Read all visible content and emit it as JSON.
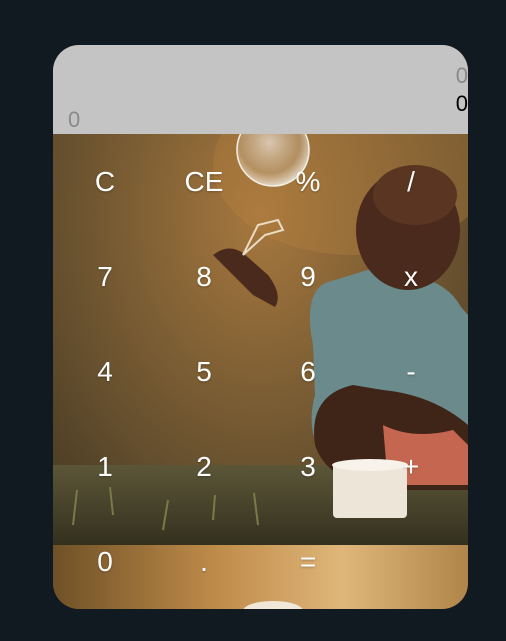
{
  "display": {
    "left_value": "0",
    "right_value_top": "0",
    "right_value_bottom": "0"
  },
  "keys": {
    "row1": [
      "C",
      "CE",
      "%",
      "/"
    ],
    "row2": [
      "7",
      "8",
      "9",
      "x"
    ],
    "row3": [
      "4",
      "5",
      "6",
      "-"
    ],
    "row4": [
      "1",
      "2",
      "3",
      "+"
    ],
    "row5": [
      "0",
      ".",
      "="
    ]
  },
  "colors": {
    "page_background": "#111921",
    "display_background": "#c4c4c4",
    "key_text": "#ffffff"
  }
}
